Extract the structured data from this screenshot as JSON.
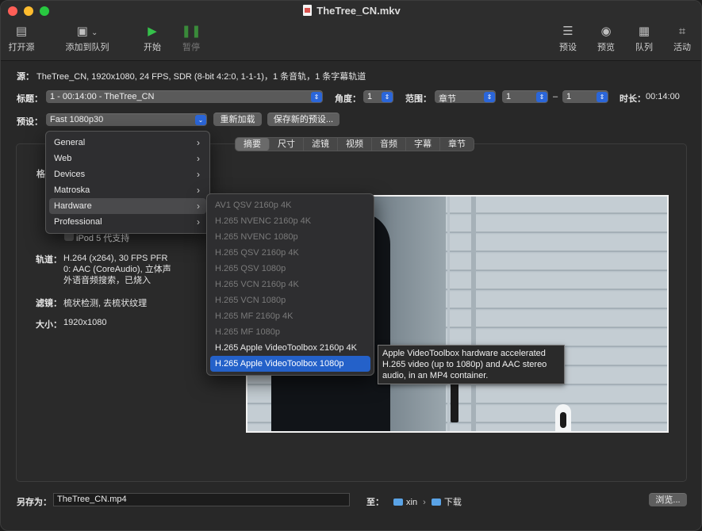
{
  "window": {
    "title": "TheTree_CN.mkv"
  },
  "toolbar": {
    "open_source": "打开源",
    "add_to_queue": "添加到队列",
    "start": "开始",
    "pause": "暂停",
    "presets": "预设",
    "preview": "预览",
    "queue": "队列",
    "activity": "活动"
  },
  "source": {
    "label": "源：",
    "value": "TheTree_CN, 1920x1080, 24 FPS, SDR (8-bit 4:2:0, 1-1-1)，1 条音轨，1 条字幕轨道"
  },
  "title_row": {
    "title_label": "标题：",
    "title_value": "1 - 00:14:00 - TheTree_CN",
    "angle_label": "角度：",
    "angle_value": "1",
    "range_label": "范围：",
    "range_type": "章节",
    "range_start": "1",
    "range_dash": "–",
    "range_end": "1",
    "duration_label": "时长：",
    "duration_value": "00:14:00"
  },
  "preset_row": {
    "label": "预设：",
    "value": "Fast 1080p30",
    "reload_button": "重新加载",
    "save_button": "保存新的预设..."
  },
  "tabs": [
    "摘要",
    "尺寸",
    "滤镜",
    "视频",
    "音频",
    "字幕",
    "章节"
  ],
  "summary": {
    "format_label": "格",
    "ipod_label": "iPod 5 代支持",
    "tracks_label": "轨道：",
    "tracks_lines": [
      "H.264 (x264), 30 FPS PFR",
      "0: AAC (CoreAudio), 立体声",
      "外语音频搜索，已烧入"
    ],
    "filters_label": "滤镜：",
    "filters_value": "梳状检测, 去梳状纹理",
    "size_label": "大小：",
    "size_value": "1920x1080"
  },
  "preset_menu": [
    {
      "label": "General"
    },
    {
      "label": "Web"
    },
    {
      "label": "Devices"
    },
    {
      "label": "Matroska"
    },
    {
      "label": "Hardware"
    },
    {
      "label": "Professional"
    }
  ],
  "hardware_submenu": [
    {
      "label": "AV1 QSV 2160p 4K",
      "enabled": false
    },
    {
      "label": "H.265 NVENC 2160p 4K",
      "enabled": false
    },
    {
      "label": "H.265 NVENC 1080p",
      "enabled": false
    },
    {
      "label": "H.265 QSV 2160p 4K",
      "enabled": false
    },
    {
      "label": "H.265 QSV 1080p",
      "enabled": false
    },
    {
      "label": "H.265 VCN 2160p 4K",
      "enabled": false
    },
    {
      "label": "H.265 VCN 1080p",
      "enabled": false
    },
    {
      "label": "H.265 MF 2160p 4K",
      "enabled": false
    },
    {
      "label": "H.265 MF 1080p",
      "enabled": false
    },
    {
      "label": "H.265 Apple VideoToolbox 2160p 4K",
      "enabled": true
    },
    {
      "label": "H.265 Apple VideoToolbox 1080p",
      "enabled": true,
      "selected": true
    }
  ],
  "tooltip": {
    "line1": "Apple VideoToolbox hardware accelerated",
    "line2": "H.265 video (up to 1080p) and AAC stereo",
    "line3": "audio, in an MP4 container."
  },
  "save_as": {
    "label": "另存为：",
    "filename": "TheTree_CN.mp4",
    "to_label": "至：",
    "path_user": "xin",
    "path_sep": "›",
    "path_folder": "下载",
    "browse_button": "浏览..."
  },
  "colors": {
    "accent": "#2461c9",
    "start_green": "#35c04a"
  }
}
